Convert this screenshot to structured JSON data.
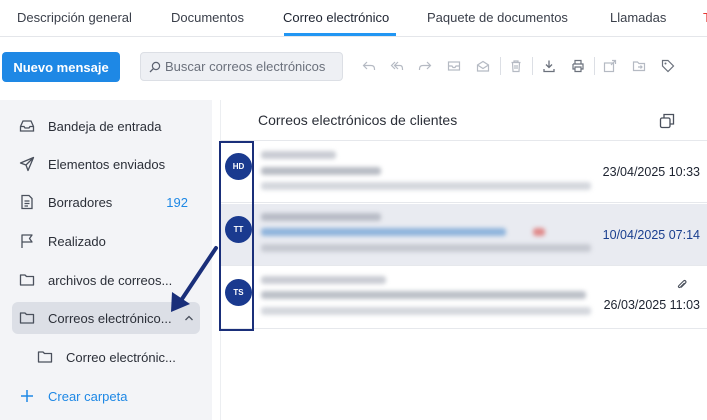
{
  "tabs": [
    {
      "label": "Descripción general"
    },
    {
      "label": "Documentos"
    },
    {
      "label": "Correo electrónico"
    },
    {
      "label": "Paquete de documentos"
    },
    {
      "label": "Llamadas"
    },
    {
      "label": "T"
    }
  ],
  "active_tab": "Correo electrónico",
  "toolbar": {
    "new_message_label": "Nuevo mensaje",
    "search_placeholder": "Buscar correos electrónicos"
  },
  "sidebar": {
    "items": [
      {
        "label": "Bandeja de entrada",
        "icon": "inbox-icon"
      },
      {
        "label": "Elementos enviados",
        "icon": "send-icon"
      },
      {
        "label": "Borradores",
        "icon": "file-icon",
        "count": "192"
      },
      {
        "label": "Realizado",
        "icon": "flag-icon"
      },
      {
        "label": "archivos de correos...",
        "icon": "folder-icon"
      },
      {
        "label": "Correos electrónico...",
        "icon": "folder-icon",
        "selected": true,
        "expanded": true
      },
      {
        "label": "Correo electrónic...",
        "icon": "folder-icon",
        "subfolder": true
      }
    ],
    "create_folder_label": "Crear carpeta"
  },
  "panel": {
    "title": "Correos electrónicos de clientes",
    "emails": [
      {
        "initials": "HD",
        "date": "23/04/2025 10:33",
        "unread": false,
        "attachment": false
      },
      {
        "initials": "TT",
        "date": "10/04/2025 07:14",
        "unread": true,
        "attachment": false
      },
      {
        "initials": "TS",
        "date": "26/03/2025 11:03",
        "unread": false,
        "attachment": true
      }
    ]
  },
  "colors": {
    "accent": "#1e88e5",
    "avatar": "#1a3a8f",
    "annotation": "#1a2f7a",
    "sidebar_bg": "#f3f4f7"
  }
}
